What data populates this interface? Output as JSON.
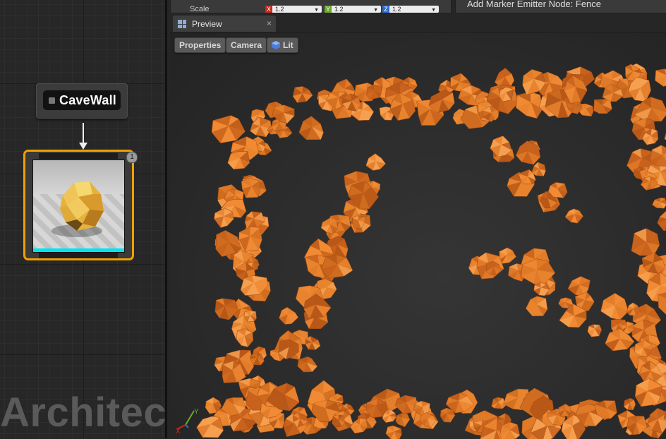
{
  "graph": {
    "marker_node": {
      "title": "CaveWall",
      "icon": "marker-node-icon"
    },
    "visual_node": {
      "thumbnail": "rock-mesh-thumbnail",
      "badge": "1",
      "accent": "#f0a000",
      "status_color": "#00e6f0"
    },
    "watermark": "Architect"
  },
  "properties": {
    "scale_label": "Scale",
    "scale_x": {
      "axis": "X",
      "value": "1.2",
      "color": "#c8281e"
    },
    "scale_y": {
      "axis": "Y",
      "value": "1.2",
      "color": "#6aaa28"
    },
    "scale_z": {
      "axis": "Z",
      "value": "1.2",
      "color": "#2a6cd6"
    }
  },
  "actions": {
    "add_marker_emitter": "Add Marker Emitter Node: Fence"
  },
  "preview": {
    "tab_label": "Preview",
    "tab_close": "×",
    "buttons": {
      "properties": "Properties",
      "camera": "Camera",
      "lit": "Lit"
    },
    "rock_color": "#e07a28",
    "axis_labels": {
      "x": "X",
      "y": "Y"
    }
  }
}
